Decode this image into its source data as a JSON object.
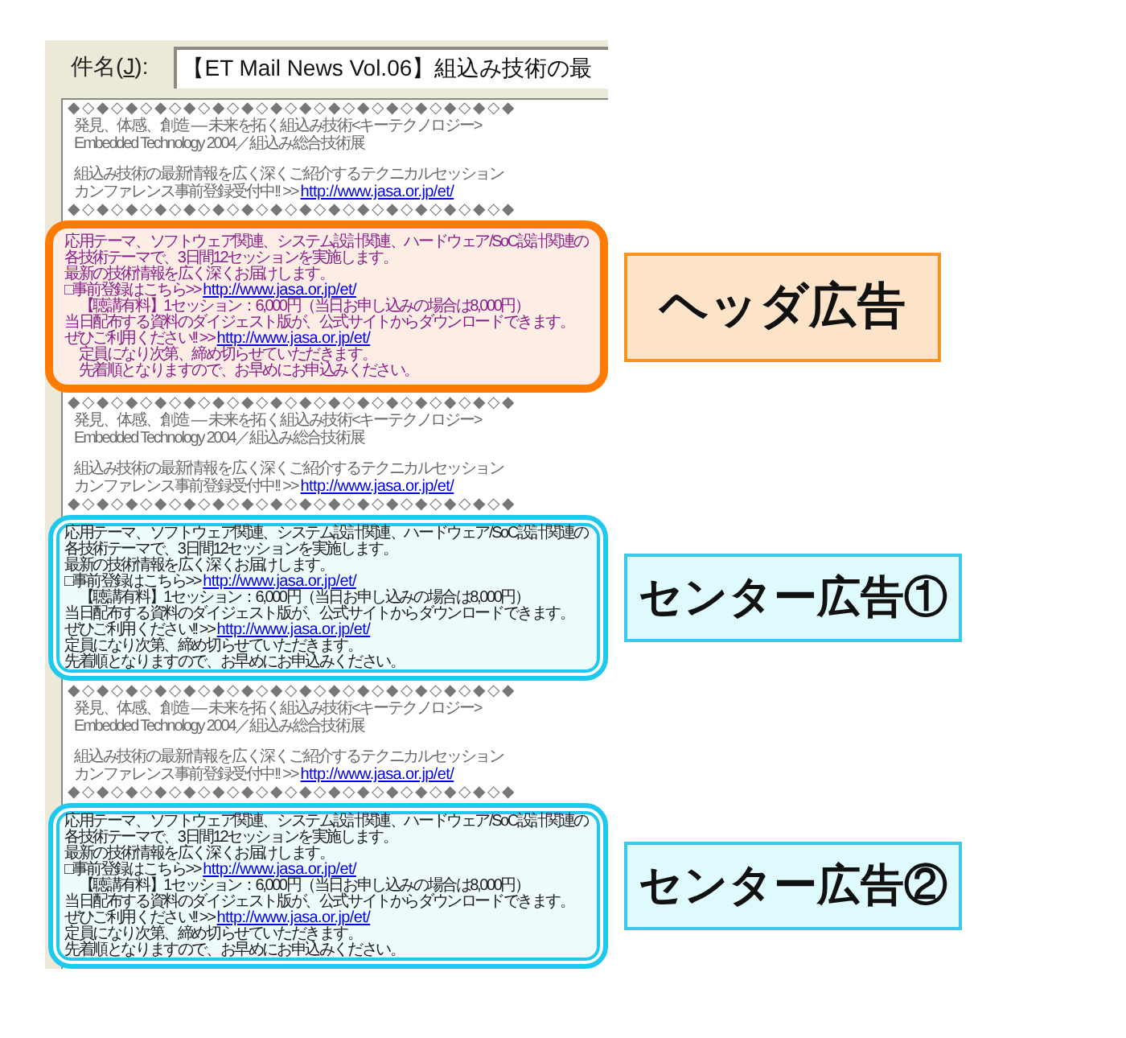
{
  "subject": {
    "label": {
      "before": "件名(",
      "access_key": "J",
      "after": "):"
    },
    "value": "【ET Mail News Vol.06】組込み技術の最"
  },
  "sections": [
    {
      "block": {
        "divider_top": "◆◇◆◇◆◇◆◇◆◇◆◇◆◇◆◇◆◇◆◇◆◇◆◇◆◇◆◇◆◇◆",
        "paragraphs": [
          {
            "lines": [
              {
                "text": "発見、体感、創造 — 未来を拓く組込み技術<キーテクノロジー>"
              },
              {
                "text": "Embedded Technology 2004／組込み総合技術展"
              }
            ]
          },
          {
            "lines": [
              {
                "text": "組込み技術の最新情報を広く深くご紹介するテクニカルセッション"
              },
              {
                "text": "カンファレンス事前登録受付中!!  >> ",
                "link": "http://www.jasa.or.jp/et/"
              }
            ]
          }
        ],
        "divider_bottom": "◆◇◆◇◆◇◆◇◆◇◆◇◆◇◆◇◆◇◆◇◆◇◆◇◆◇◆◇◆◇◆"
      },
      "ad": {
        "kind": "header",
        "label": "ヘッダ広告",
        "lines": [
          {
            "text": "応用テーマ、ソフトウェア関連、システム設計関連、ハードウェア/SoC設計関連の"
          },
          {
            "text": "各技術テーマで、3日間12セッションを実施します。"
          },
          {
            "text": "最新の技術情報を広く深くお届けします。"
          },
          {
            "text": "□事前登録はこちら>> ",
            "link": "http://www.jasa.or.jp/et/"
          },
          {
            "text": "　【聴講有料】1セッション：6,000円（当日お申し込みの場合は8,000円）"
          },
          {
            "text": "当日配布する資料のダイジェスト版が、公式サイトからダウンロードできます。"
          },
          {
            "text": "ぜひご利用ください!! >> ",
            "link": "http://www.jasa.or.jp/et/"
          },
          {
            "text": "　定員になり次第、締め切らせていただきます。"
          },
          {
            "text": "　先着順となりますので、お早めにお申込みください。"
          }
        ]
      }
    },
    {
      "block": {
        "divider_top": "◆◇◆◇◆◇◆◇◆◇◆◇◆◇◆◇◆◇◆◇◆◇◆◇◆◇◆◇◆◇◆",
        "paragraphs": [
          {
            "lines": [
              {
                "text": "発見、体感、創造 — 未来を拓く組込み技術<キーテクノロジー>"
              },
              {
                "text": "Embedded Technology 2004／組込み総合技術展"
              }
            ]
          },
          {
            "lines": [
              {
                "text": "組込み技術の最新情報を広く深くご紹介するテクニカルセッション"
              },
              {
                "text": "カンファレンス事前登録受付中!!  >> ",
                "link": "http://www.jasa.or.jp/et/"
              }
            ]
          }
        ],
        "divider_bottom": "◆◇◆◇◆◇◆◇◆◇◆◇◆◇◆◇◆◇◆◇◆◇◆◇◆◇◆◇◆◇◆"
      },
      "ad": {
        "kind": "center",
        "label": "センター広告①",
        "lines": [
          {
            "text": "応用テーマ、ソフトウェア関連、システム設計関連、ハードウェア/SoC設計関連の"
          },
          {
            "text": "各技術テーマで、3日間12セッションを実施します。"
          },
          {
            "text": "最新の技術情報を広く深くお届けします。"
          },
          {
            "text": "□事前登録はこちら>> ",
            "link": "http://www.jasa.or.jp/et/"
          },
          {
            "text": "　【聴講有料】1セッション：6,000円（当日お申し込みの場合は8,000円）"
          },
          {
            "text": "当日配布する資料のダイジェスト版が、公式サイトからダウンロードできます。"
          },
          {
            "text": "ぜひご利用ください!! >> ",
            "link": "http://www.jasa.or.jp/et/"
          },
          {
            "text": "定員になり次第、締め切らせていただきます。"
          },
          {
            "text": "先着順となりますので、お早めにお申込みください。"
          }
        ]
      }
    },
    {
      "block": {
        "divider_top": "◆◇◆◇◆◇◆◇◆◇◆◇◆◇◆◇◆◇◆◇◆◇◆◇◆◇◆◇◆◇◆",
        "paragraphs": [
          {
            "lines": [
              {
                "text": "発見、体感、創造 — 未来を拓く組込み技術<キーテクノロジー>"
              },
              {
                "text": "Embedded Technology 2004／組込み総合技術展"
              }
            ]
          },
          {
            "lines": [
              {
                "text": "組込み技術の最新情報を広く深くご紹介するテクニカルセッション"
              },
              {
                "text": "カンファレンス事前登録受付中!!  >> ",
                "link": "http://www.jasa.or.jp/et/"
              }
            ]
          }
        ],
        "divider_bottom": "◆◇◆◇◆◇◆◇◆◇◆◇◆◇◆◇◆◇◆◇◆◇◆◇◆◇◆◇◆◇◆"
      },
      "ad": {
        "kind": "center",
        "label": "センター広告②",
        "lines": [
          {
            "text": "応用テーマ、ソフトウェア関連、システム設計関連、ハードウェア/SoC設計関連の"
          },
          {
            "text": "各技術テーマで、3日間12セッションを実施します。"
          },
          {
            "text": "最新の技術情報を広く深くお届けします。"
          },
          {
            "text": "□事前登録はこちら>> ",
            "link": "http://www.jasa.or.jp/et/"
          },
          {
            "text": "　【聴講有料】1セッション：6,000円（当日お申し込みの場合は8,000円）"
          },
          {
            "text": "当日配布する資料のダイジェスト版が、公式サイトからダウンロードできます。"
          },
          {
            "text": "ぜひご利用ください!! >> ",
            "link": "http://www.jasa.or.jp/et/"
          },
          {
            "text": "定員になり次第、締め切らせていただきます。"
          },
          {
            "text": "先着順となりますので、お早めにお申込みください。"
          }
        ]
      }
    }
  ]
}
